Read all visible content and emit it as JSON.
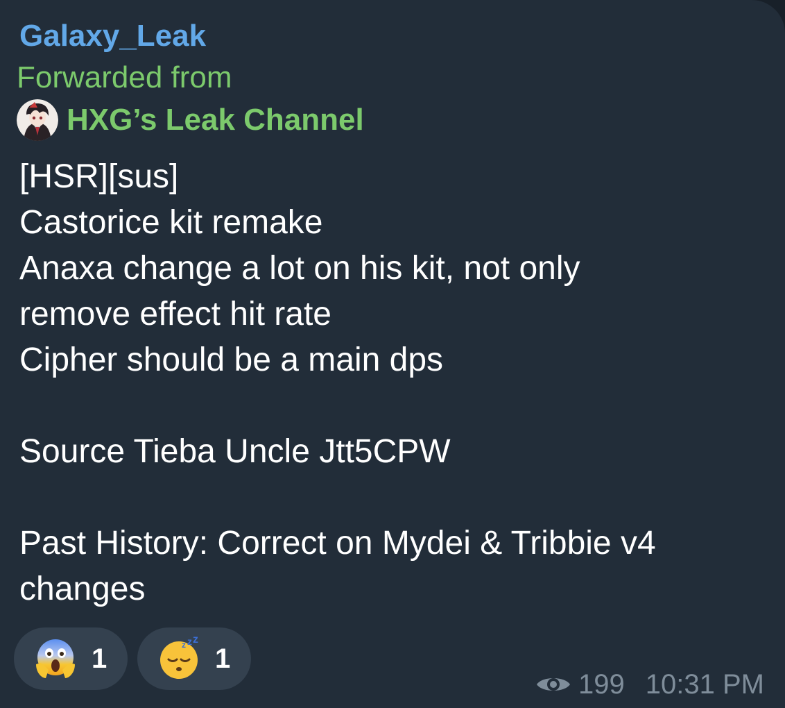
{
  "message": {
    "sender": "Galaxy_Leak",
    "forwarded_label": "Forwarded from",
    "forwarded_channel": "HXG’s Leak Channel",
    "lines": [
      "[HSR][sus]",
      "Castorice kit remake",
      "Anaxa change a lot on his kit, not only",
      "remove effect hit rate",
      "Cipher should be a main dps",
      "",
      "Source Tieba Uncle Jtt5CPW",
      "",
      "Past History: Correct on Mydei & Tribbie v4",
      "changes"
    ],
    "reactions": [
      {
        "emoji": "screaming-face-emoji",
        "count": "1"
      },
      {
        "emoji": "sleeping-face-emoji",
        "count": "1"
      }
    ],
    "views": "199",
    "time": "10:31 PM"
  },
  "colors": {
    "bubble_bg": "#222d39",
    "sender": "#62a8e8",
    "forward": "#7cca6c",
    "text": "#ffffff",
    "meta": "#7f8d9a",
    "reaction_bg": "#34414f"
  }
}
